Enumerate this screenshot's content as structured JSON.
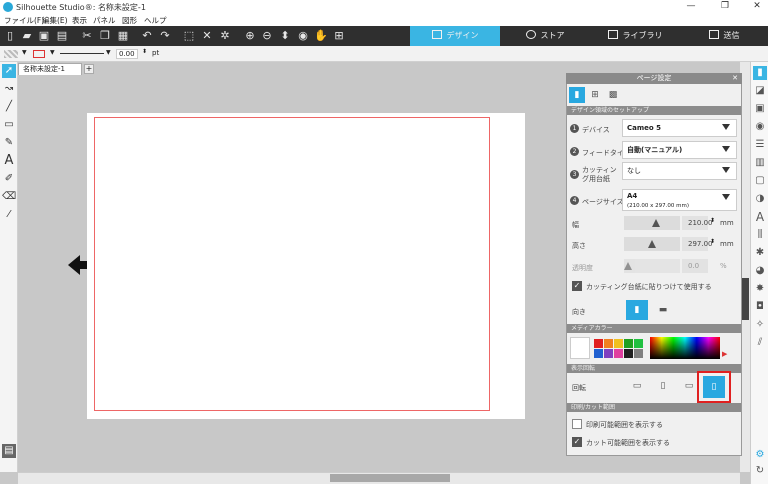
{
  "window": {
    "title": "Silhouette Studio®: 名称未設定-1",
    "min": "—",
    "max": "❐",
    "close": "✕"
  },
  "menu": [
    "ファイル(F)",
    "編集(E)",
    "表示",
    "パネル",
    "図形",
    "ヘルプ"
  ],
  "nav_tabs": [
    {
      "label": "デザイン",
      "active": true
    },
    {
      "label": "ストア",
      "active": false
    },
    {
      "label": "ライブラリ",
      "active": false
    },
    {
      "label": "送信",
      "active": false
    }
  ],
  "optbar": {
    "stroke_value": "0.00",
    "stroke_unit": "pt"
  },
  "doc_tab": {
    "label": "名称未設定-1",
    "add": "+"
  },
  "panel": {
    "title": "ページ設定",
    "section_setup": "デザイン領域のセットアップ",
    "device": {
      "num": "1",
      "label": "デバイス",
      "value": "Cameo 5"
    },
    "feed": {
      "num": "2",
      "label": "フィードタイプ",
      "value": "自動(マニュアル)"
    },
    "mat": {
      "num": "3",
      "label": "カッティング用台紙",
      "value": "なし"
    },
    "pagesize": {
      "num": "4",
      "label": "ページサイズ",
      "value": "A4",
      "sub": "(210.00 x 297.00 mm)"
    },
    "width": {
      "label": "幅",
      "value": "210.00",
      "unit": "mm",
      "level": 0.55
    },
    "height": {
      "label": "高さ",
      "value": "297.00",
      "unit": "mm",
      "level": 0.5
    },
    "transparency": {
      "label": "透明度",
      "value": "0.0",
      "unit": "%",
      "level": 0.0
    },
    "attach_mat": {
      "label": "カッティング台紙に貼りつけて使用する",
      "checked": true
    },
    "orientation_label": "向き",
    "section_media": "メディアカラー",
    "section_view": "表示回転",
    "rotate_label": "回転",
    "section_print": "印刷/カット範囲",
    "show_print": {
      "label": "印刷可能範囲を表示する",
      "checked": false
    },
    "show_cut": {
      "label": "カット可能範囲を表示する",
      "checked": true
    },
    "swatches": [
      "#e02020",
      "#f08020",
      "#f0c020",
      "#20a020",
      "#20c040",
      "#2060d0",
      "#8040c0",
      "#e040a0",
      "#202020",
      "#808080"
    ],
    "highlight_color": "#e02020",
    "accent": "#29a8e0"
  }
}
